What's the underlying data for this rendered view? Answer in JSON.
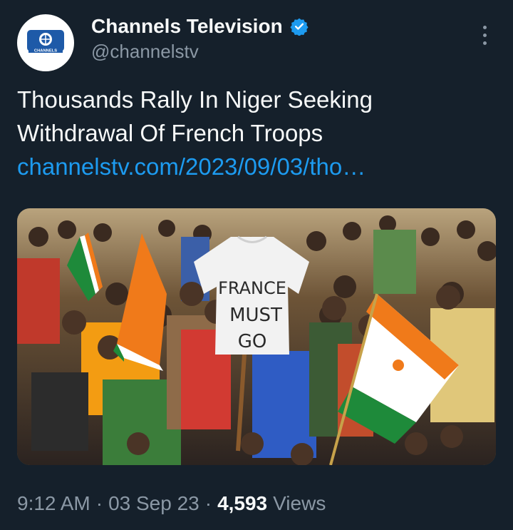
{
  "account": {
    "name": "Channels Television",
    "handle": "@channelstv",
    "verified": true,
    "avatar_text": "CHANNELS",
    "accent": "#1d9bf0"
  },
  "tweet": {
    "text": "Thousands Rally In Niger Seeking Withdrawal Of French Troops",
    "link": "channelstv.com/2023/09/03/tho…"
  },
  "media": {
    "shirt_text_line1": "FRANCE",
    "shirt_text_line2": "MUST",
    "shirt_text_line3": "GO"
  },
  "meta": {
    "time": "9:12 AM",
    "separator": "·",
    "date": "03 Sep 23",
    "views_count": "4,593",
    "views_label": "Views"
  },
  "icons": {
    "verified": "verified-badge-icon",
    "more": "more-icon"
  }
}
